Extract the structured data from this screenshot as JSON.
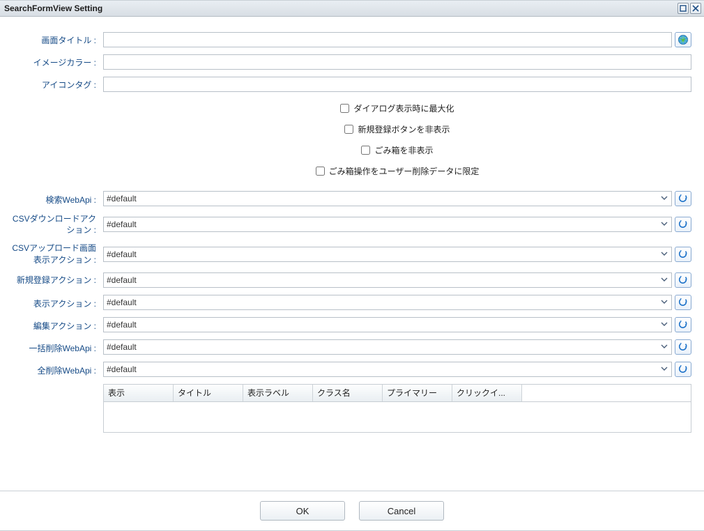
{
  "window": {
    "title": "SearchFormView Setting"
  },
  "labels": {
    "screenTitle": "画面タイトル :",
    "imageColor": "イメージカラー :",
    "iconTag": "アイコンタグ :",
    "searchWebApi": "検索WebApi :",
    "csvDownloadAction": "CSVダウンロードアクション :",
    "csvUploadViewAction": "CSVアップロード画面表示アクション :",
    "newRegisterAction": "新規登録アクション :",
    "viewAction": "表示アクション :",
    "editAction": "編集アクション :",
    "batchDeleteWebApi": "一括削除WebApi :",
    "allDeleteWebApi": "全削除WebApi :"
  },
  "checks": {
    "maximizeOnDialog": "ダイアログ表示時に最大化",
    "hideNewButton": "新規登録ボタンを非表示",
    "hideTrash": "ごみ箱を非表示",
    "trashUserDeletedOnly": "ごみ箱操作をユーザー削除データに限定"
  },
  "values": {
    "screenTitle": "",
    "imageColor": "",
    "iconTag": "",
    "searchWebApi": "#default",
    "csvDownloadAction": "#default",
    "csvUploadViewAction": "#default",
    "newRegisterAction": "#default",
    "viewAction": "#default",
    "editAction": "#default",
    "batchDeleteWebApi": "#default",
    "allDeleteWebApi": "#default"
  },
  "gridHeaders": [
    "表示",
    "タイトル",
    "表示ラベル",
    "クラス名",
    "プライマリー",
    "クリックイ..."
  ],
  "footer": {
    "ok": "OK",
    "cancel": "Cancel"
  }
}
